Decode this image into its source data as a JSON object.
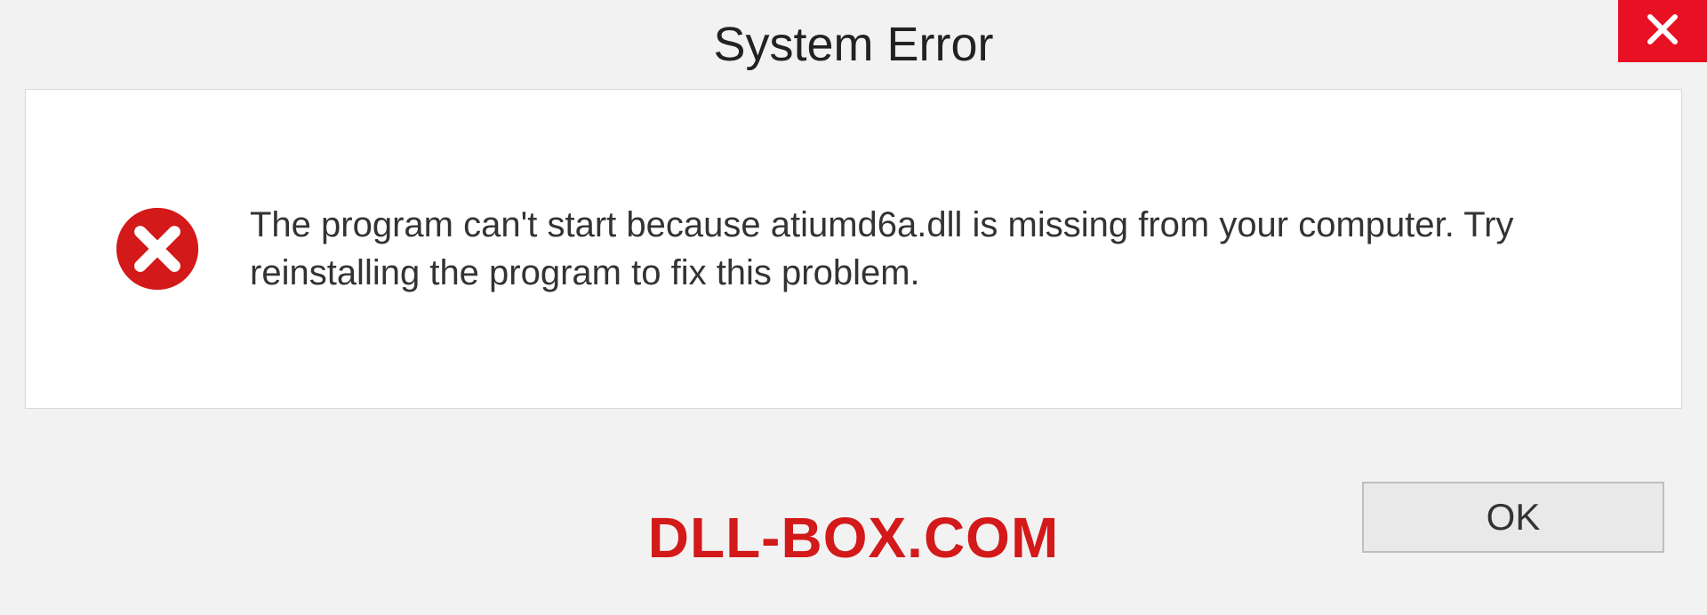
{
  "dialog": {
    "title": "System Error",
    "message": "The program can't start because atiumd6a.dll is missing from your computer. Try reinstalling the program to fix this problem.",
    "ok_label": "OK"
  },
  "watermark": "DLL-BOX.COM",
  "colors": {
    "close_bg": "#e81123",
    "error_red": "#d31919"
  }
}
